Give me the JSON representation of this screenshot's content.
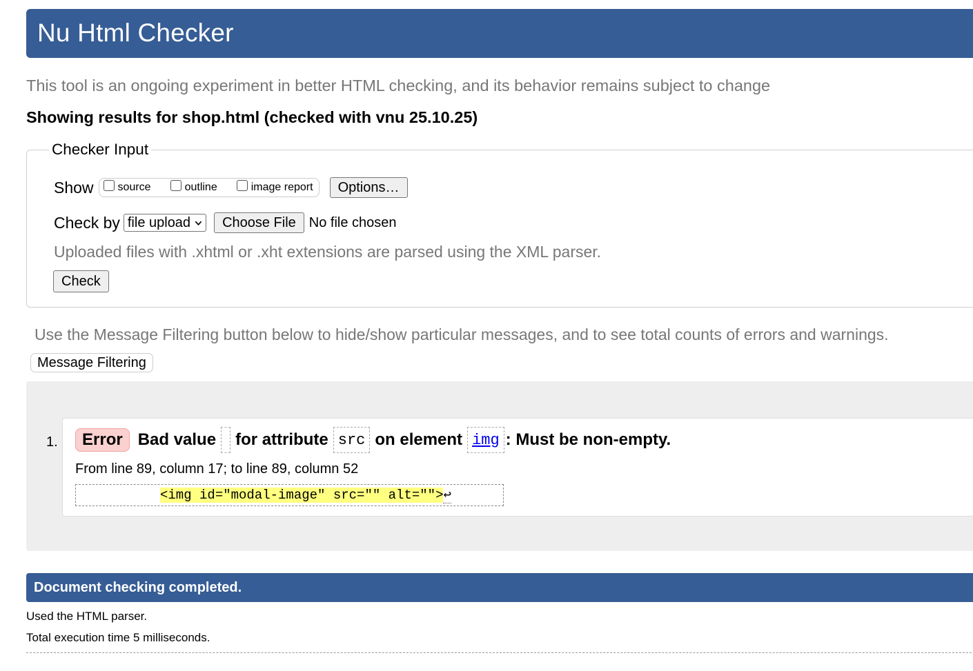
{
  "header": {
    "title": "Nu Html Checker"
  },
  "intro": "This tool is an ongoing experiment in better HTML checking, and its behavior remains subject to change",
  "showing": "Showing results for shop.html (checked with vnu 25.10.25)",
  "checker_input": {
    "legend": "Checker Input",
    "show_label": "Show",
    "show_options": [
      {
        "label": "source",
        "checked": false
      },
      {
        "label": "outline",
        "checked": false
      },
      {
        "label": "image report",
        "checked": false
      }
    ],
    "options_button": "Options…",
    "check_by_label": "Check by",
    "check_by_selected": "file upload",
    "choose_file_button": "Choose File",
    "file_status": "No file chosen",
    "hint": "Uploaded files with .xhtml or .xht extensions are parsed using the XML parser.",
    "check_button": "Check"
  },
  "filtering": {
    "text": "Use the Message Filtering button below to hide/show particular messages, and to see total counts of errors and warnings.",
    "button": "Message Filtering"
  },
  "messages": [
    {
      "number": "1.",
      "type": "Error",
      "text_1": "Bad value",
      "text_2": "for attribute",
      "attr": "src",
      "text_3": "on element",
      "element": "img",
      "text_4": ": Must be non-empty.",
      "location": "From line 89, column 17; to line 89, column 52",
      "extract": "<img id=\"modal-image\" src=\"\" alt=\"\">",
      "extract_tail": "↩"
    }
  ],
  "footer": {
    "done": "Document checking completed.",
    "parser": "Used the HTML parser.",
    "time": "Total execution time 5 milliseconds."
  },
  "colors": {
    "brand": "#365d95",
    "error_badge": "#fbd1d0",
    "highlight": "#ffff80"
  }
}
